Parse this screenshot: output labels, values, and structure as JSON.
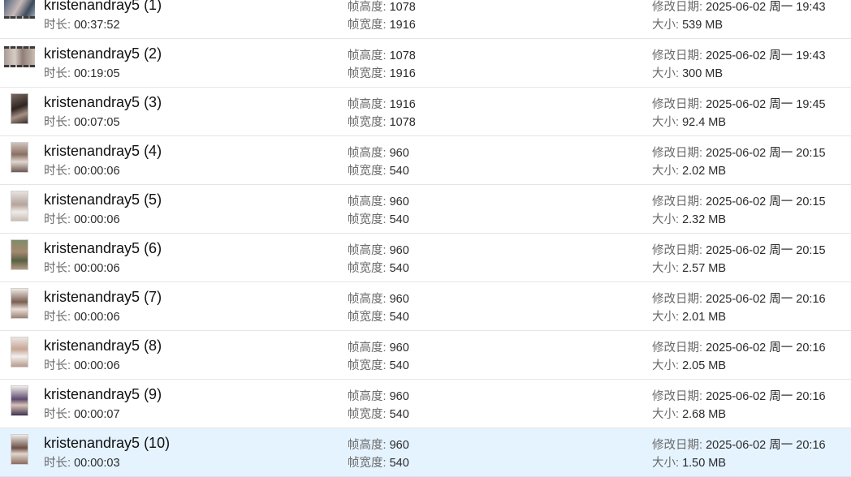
{
  "labels": {
    "duration": "时长: ",
    "frame_height": "帧高度: ",
    "frame_width": "帧宽度: ",
    "modified": "修改日期: ",
    "size": "大小: "
  },
  "colors": {
    "selected_row_background": "#e5f3ff",
    "row_divider": "#e5e5e5"
  },
  "files": [
    {
      "name": "kristenandray5 (1)",
      "duration": "00:37:52",
      "frame_height": "1078",
      "frame_width": "1916",
      "modified": "2025-06-02 周一 19:43",
      "size": "539 MB",
      "thumbnail": "video-film-thumbnail",
      "selected": false
    },
    {
      "name": "kristenandray5 (2)",
      "duration": "00:19:05",
      "frame_height": "1078",
      "frame_width": "1916",
      "modified": "2025-06-02 周一 19:43",
      "size": "300 MB",
      "thumbnail": "video-film-thumbnail",
      "selected": false
    },
    {
      "name": "kristenandray5 (3)",
      "duration": "00:07:05",
      "frame_height": "1916",
      "frame_width": "1078",
      "modified": "2025-06-02 周一 19:45",
      "size": "92.4 MB",
      "thumbnail": "dark-portrait-thumbnail",
      "selected": false
    },
    {
      "name": "kristenandray5 (4)",
      "duration": "00:00:06",
      "frame_height": "960",
      "frame_width": "540",
      "modified": "2025-06-02 周一 20:15",
      "size": "2.02 MB",
      "thumbnail": "portrait-thumbnail",
      "selected": false
    },
    {
      "name": "kristenandray5 (5)",
      "duration": "00:00:06",
      "frame_height": "960",
      "frame_width": "540",
      "modified": "2025-06-02 周一 20:15",
      "size": "2.32 MB",
      "thumbnail": "portrait-thumbnail",
      "selected": false
    },
    {
      "name": "kristenandray5 (6)",
      "duration": "00:00:06",
      "frame_height": "960",
      "frame_width": "540",
      "modified": "2025-06-02 周一 20:15",
      "size": "2.57 MB",
      "thumbnail": "portrait-thumbnail",
      "selected": false
    },
    {
      "name": "kristenandray5 (7)",
      "duration": "00:00:06",
      "frame_height": "960",
      "frame_width": "540",
      "modified": "2025-06-02 周一 20:16",
      "size": "2.01 MB",
      "thumbnail": "portrait-thumbnail",
      "selected": false
    },
    {
      "name": "kristenandray5 (8)",
      "duration": "00:00:06",
      "frame_height": "960",
      "frame_width": "540",
      "modified": "2025-06-02 周一 20:16",
      "size": "2.05 MB",
      "thumbnail": "portrait-thumbnail",
      "selected": false
    },
    {
      "name": "kristenandray5 (9)",
      "duration": "00:00:07",
      "frame_height": "960",
      "frame_width": "540",
      "modified": "2025-06-02 周一 20:16",
      "size": "2.68 MB",
      "thumbnail": "portrait-thumbnail",
      "selected": false
    },
    {
      "name": "kristenandray5 (10)",
      "duration": "00:00:03",
      "frame_height": "960",
      "frame_width": "540",
      "modified": "2025-06-02 周一 20:16",
      "size": "1.50 MB",
      "thumbnail": "portrait-thumbnail",
      "selected": true
    }
  ]
}
